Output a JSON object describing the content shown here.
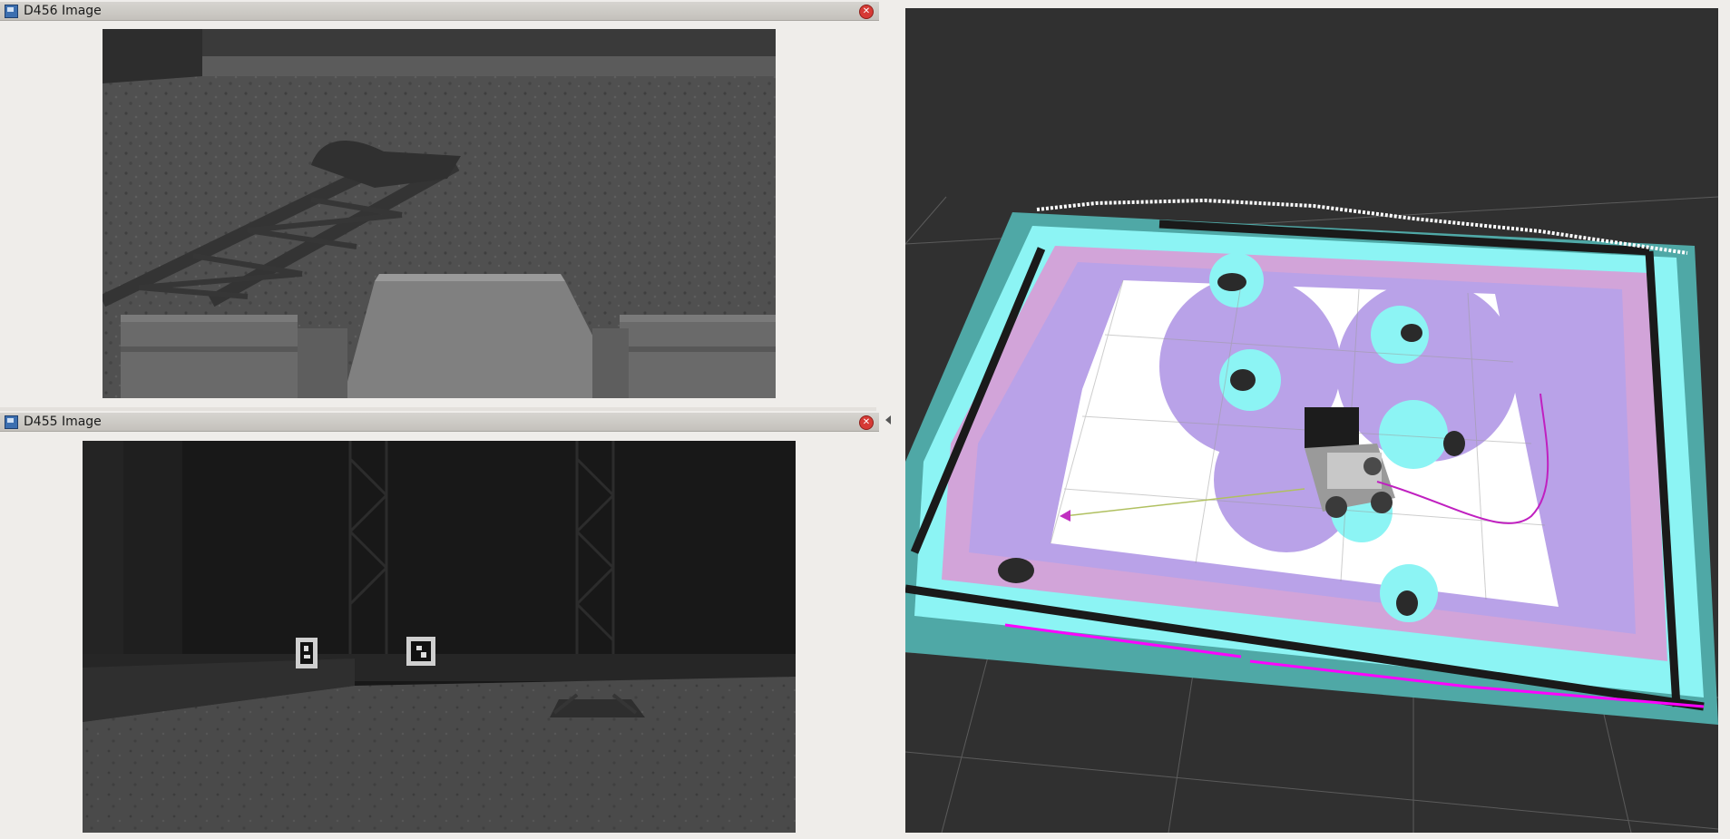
{
  "panels": [
    {
      "title": "D456 Image"
    },
    {
      "title": "D455 Image"
    }
  ],
  "colors": {
    "title_bar": "#c9c6c1",
    "close_button": "#d63a35",
    "rviz_background": "#303030",
    "costmap_lethal": "#ff00ff",
    "costmap_inflated": "#8cf4f4",
    "costmap_gradient": "#b9a2e8",
    "free_space": "#ffffff",
    "plan_path": "#c020c0",
    "goal_arrow": "#b0c060"
  },
  "icons": [
    "image-view-icon",
    "close-icon",
    "collapse-arrow-icon"
  ]
}
